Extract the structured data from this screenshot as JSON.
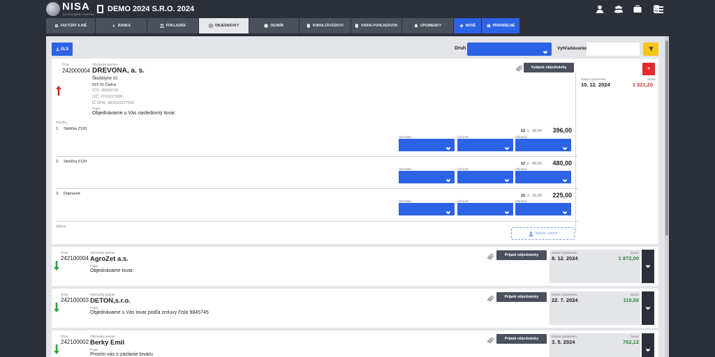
{
  "header": {
    "logo_text": "NISA",
    "logo_sub": "CUSTOMER PORTAL",
    "company": "DEMO 2024 S.R.O. 2024",
    "icons": [
      "user-icon",
      "users-icon",
      "briefcase-icon",
      "calculator-icon"
    ]
  },
  "nav": {
    "tabs": [
      {
        "label": "FAKTÚRY A INÉ",
        "icon": "gear-icon"
      },
      {
        "label": "BANKA",
        "icon": "arrow-left-icon"
      },
      {
        "label": "POKLADŇA",
        "icon": "bank-icon"
      },
      {
        "label": "OBJEDNÁVKY",
        "icon": "clock-icon"
      },
      {
        "label": "DENNÍK",
        "icon": "cube-icon"
      },
      {
        "label": "KNIHA ZÁVÄZKOV",
        "icon": "book-icon"
      },
      {
        "label": "KNIHA POHĽADÁVOK",
        "icon": "book-icon"
      },
      {
        "label": "UPOMIENKY",
        "icon": "bell-icon"
      },
      {
        "label": "NOVÉ",
        "icon": "plus-icon"
      },
      {
        "label": "PRAVIDELNÉ",
        "icon": "hash-icon"
      }
    ]
  },
  "toolbar": {
    "xls_label": "XLS",
    "druh_label": "Druh",
    "search_label": "Vyhľadávanie",
    "search_value": "",
    "search_placeholder": ""
  },
  "labels": {
    "cislo": "Číslo",
    "partner": "Obchodný partner",
    "popis": "Popis",
    "polozky": "Položky",
    "subory": "Súbory",
    "datum": "Dátum vystavenia",
    "suma": "Suma",
    "stredisko": "Stredisko",
    "cinnost": "Činnosť",
    "zakazka": "Zákazka",
    "upload": "Nahrať súbory"
  },
  "expanded_order": {
    "number": "242000004",
    "partner": "DREVONA, a. s.",
    "address1": "Škultétyho 10",
    "address2": "022 01 Čadca",
    "ico": "IČO: 36003735",
    "dic": "DIČ: 2010227659",
    "icdph": "IČ DPH: SK2010227659",
    "description": "Objednávame u Vás nasledovný tovar:",
    "type_label": "Vydané objednávky",
    "close_label": "×",
    "date": "10. 12. 2024",
    "sum": "1 321,20",
    "sum_color": "#c0392b",
    "direction": "up",
    "items": [
      {
        "index": "1.",
        "name": "Stolička Z100",
        "qty": "12",
        "x": "x",
        "price": "33,00",
        "total": "396,00"
      },
      {
        "index": "2.",
        "name": "Stolička Z120",
        "qty": "12",
        "x": "x",
        "price": "40,00",
        "total": "480,00"
      },
      {
        "index": "3.",
        "name": "Dopravné",
        "qty": "15",
        "x": "x",
        "price": "15,00",
        "total": "225,00"
      }
    ]
  },
  "orders": [
    {
      "number": "242100004",
      "partner": "AgroZet a.s.",
      "description": "Objednávame tovar:",
      "type_label": "Prijaté objednávky",
      "date": "8. 12. 2024",
      "sum": "1 872,00"
    },
    {
      "number": "242100003",
      "partner": "DETON,s.r.o.",
      "description": "Objednávame u Vás tovar podľa zmluvy číslo 9845745",
      "type_label": "Prijaté objednávky",
      "date": "22. 7. 2024",
      "sum": "119,50"
    },
    {
      "number": "242100002",
      "partner": "Berky Emil",
      "description": "Prosím vás o zaslanie tovaru",
      "type_label": "Prijaté objednávky",
      "date": "3. 5. 2024",
      "sum": "762,12"
    }
  ],
  "colors": {
    "accent": "#2c62e5",
    "sum_positive": "#2e8b3e",
    "sum_negative": "#c0392b",
    "arrow_up": "#d62828",
    "arrow_down": "#2e9e44",
    "filter": "#f5c518"
  }
}
